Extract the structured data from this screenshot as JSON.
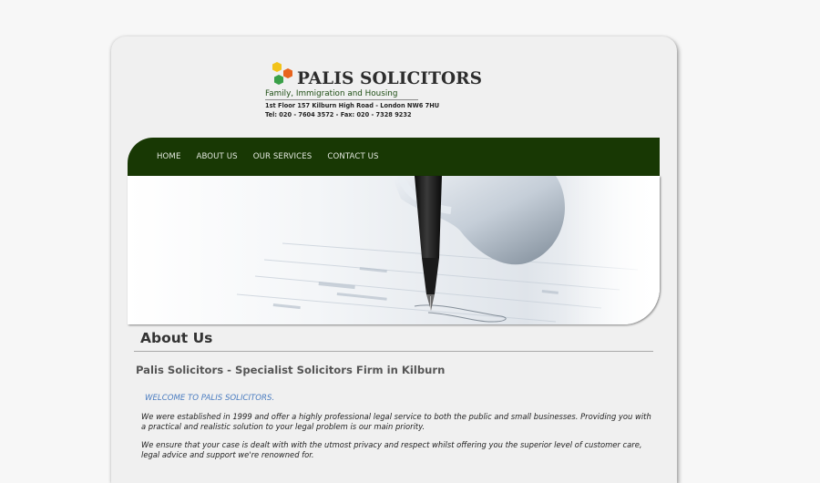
{
  "brand": {
    "name": "PALIS SOLICITORS",
    "tagline": "Family, Immigration and Housing",
    "address": "1st Floor 157 Kilburn High Road - London NW6 7HU",
    "phone": "Tel: 020 - 7604 3572 - Fax: 020 - 7328 9232"
  },
  "nav": {
    "items": [
      {
        "label": "HOME"
      },
      {
        "label": "ABOUT US"
      },
      {
        "label": "OUR SERVICES"
      },
      {
        "label": "CONTACT US"
      }
    ]
  },
  "content": {
    "title": "About Us",
    "subtitle": "Palis Solicitors - Specialist Solicitors Firm in Kilburn",
    "welcome": "WELCOME TO PALIS SOLICITORS.",
    "paragraphs": [
      "We were established in 1999 and offer a highly professional legal service to both the public and small businesses. Providing you with a practical and realistic solution to your legal problem is our main priority.",
      "We ensure that your case is dealt with with the utmost privacy and respect whilst offering you the superior level of customer care, legal advice and support we're renowned for."
    ]
  },
  "colors": {
    "nav_bg": "#183804",
    "tagline": "#1e4d14",
    "welcome": "#4a7cc0",
    "logo_yellow": "#f2c31a",
    "logo_orange": "#e8641e",
    "logo_green": "#3aa048"
  }
}
